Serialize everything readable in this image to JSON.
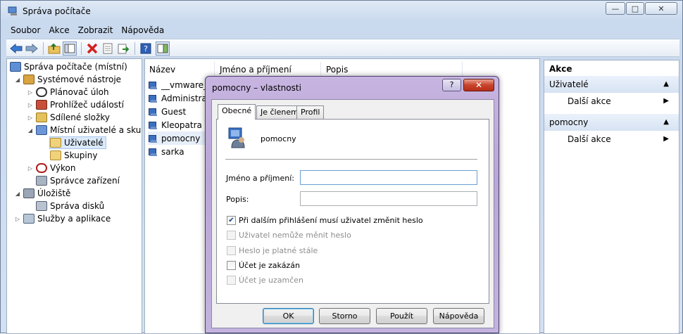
{
  "window": {
    "title": "Správa počítače",
    "minimize": "—",
    "maximize": "□",
    "close": "✕"
  },
  "menu": [
    "Soubor",
    "Akce",
    "Zobrazit",
    "Nápověda"
  ],
  "toolbar": {
    "icons": [
      "back-icon",
      "forward-icon",
      "up-folder-icon",
      "show-hide-tree-icon",
      "delete-icon",
      "properties-icon",
      "export-icon",
      "help-icon",
      "action-pane-icon"
    ]
  },
  "tree": {
    "root": "Správa počítače (místní)",
    "system_tools": "Systémové nástroje",
    "task_scheduler": "Plánovač úloh",
    "event_viewer": "Prohlížeč událostí",
    "shared_folders": "Sdílené složky",
    "local_users": "Místní uživatelé a skupiny",
    "users": "Uživatelé",
    "groups": "Skupiny",
    "performance": "Výkon",
    "device_manager": "Správce zařízení",
    "storage": "Úložiště",
    "disk_management": "Správa disků",
    "services": "Služby a aplikace"
  },
  "list": {
    "columns": [
      "Název",
      "Jméno a příjmení",
      "Popis"
    ],
    "rows": [
      "__vmware_u",
      "Administrato",
      "Guest",
      "Kleopatra",
      "pomocny",
      "sarka"
    ]
  },
  "actions": {
    "title": "Akce",
    "section1": "Uživatelé",
    "section1_more": "Další akce",
    "section2": "pomocny",
    "section2_more": "Další akce"
  },
  "dialog": {
    "title": "pomocny – vlastnosti",
    "help": "?",
    "close": "✕",
    "tabs": [
      "Obecné",
      "Je členem",
      "Profil"
    ],
    "username": "pomocny",
    "full_name_label": "Jméno a příjmení:",
    "full_name_value": "",
    "description_label": "Popis:",
    "description_value": "",
    "checkboxes": [
      {
        "label": "Při dalším přihlášení musí uživatel změnit heslo",
        "checked": true,
        "enabled": true
      },
      {
        "label": "Uživatel nemůže měnit heslo",
        "checked": false,
        "enabled": false
      },
      {
        "label": "Heslo je platné stále",
        "checked": false,
        "enabled": false
      },
      {
        "label": "Účet je zakázán",
        "checked": false,
        "enabled": true
      },
      {
        "label": "Účet je uzamčen",
        "checked": false,
        "enabled": false
      }
    ],
    "buttons": {
      "ok": "OK",
      "cancel": "Storno",
      "apply": "Použít",
      "help": "Nápověda"
    }
  }
}
